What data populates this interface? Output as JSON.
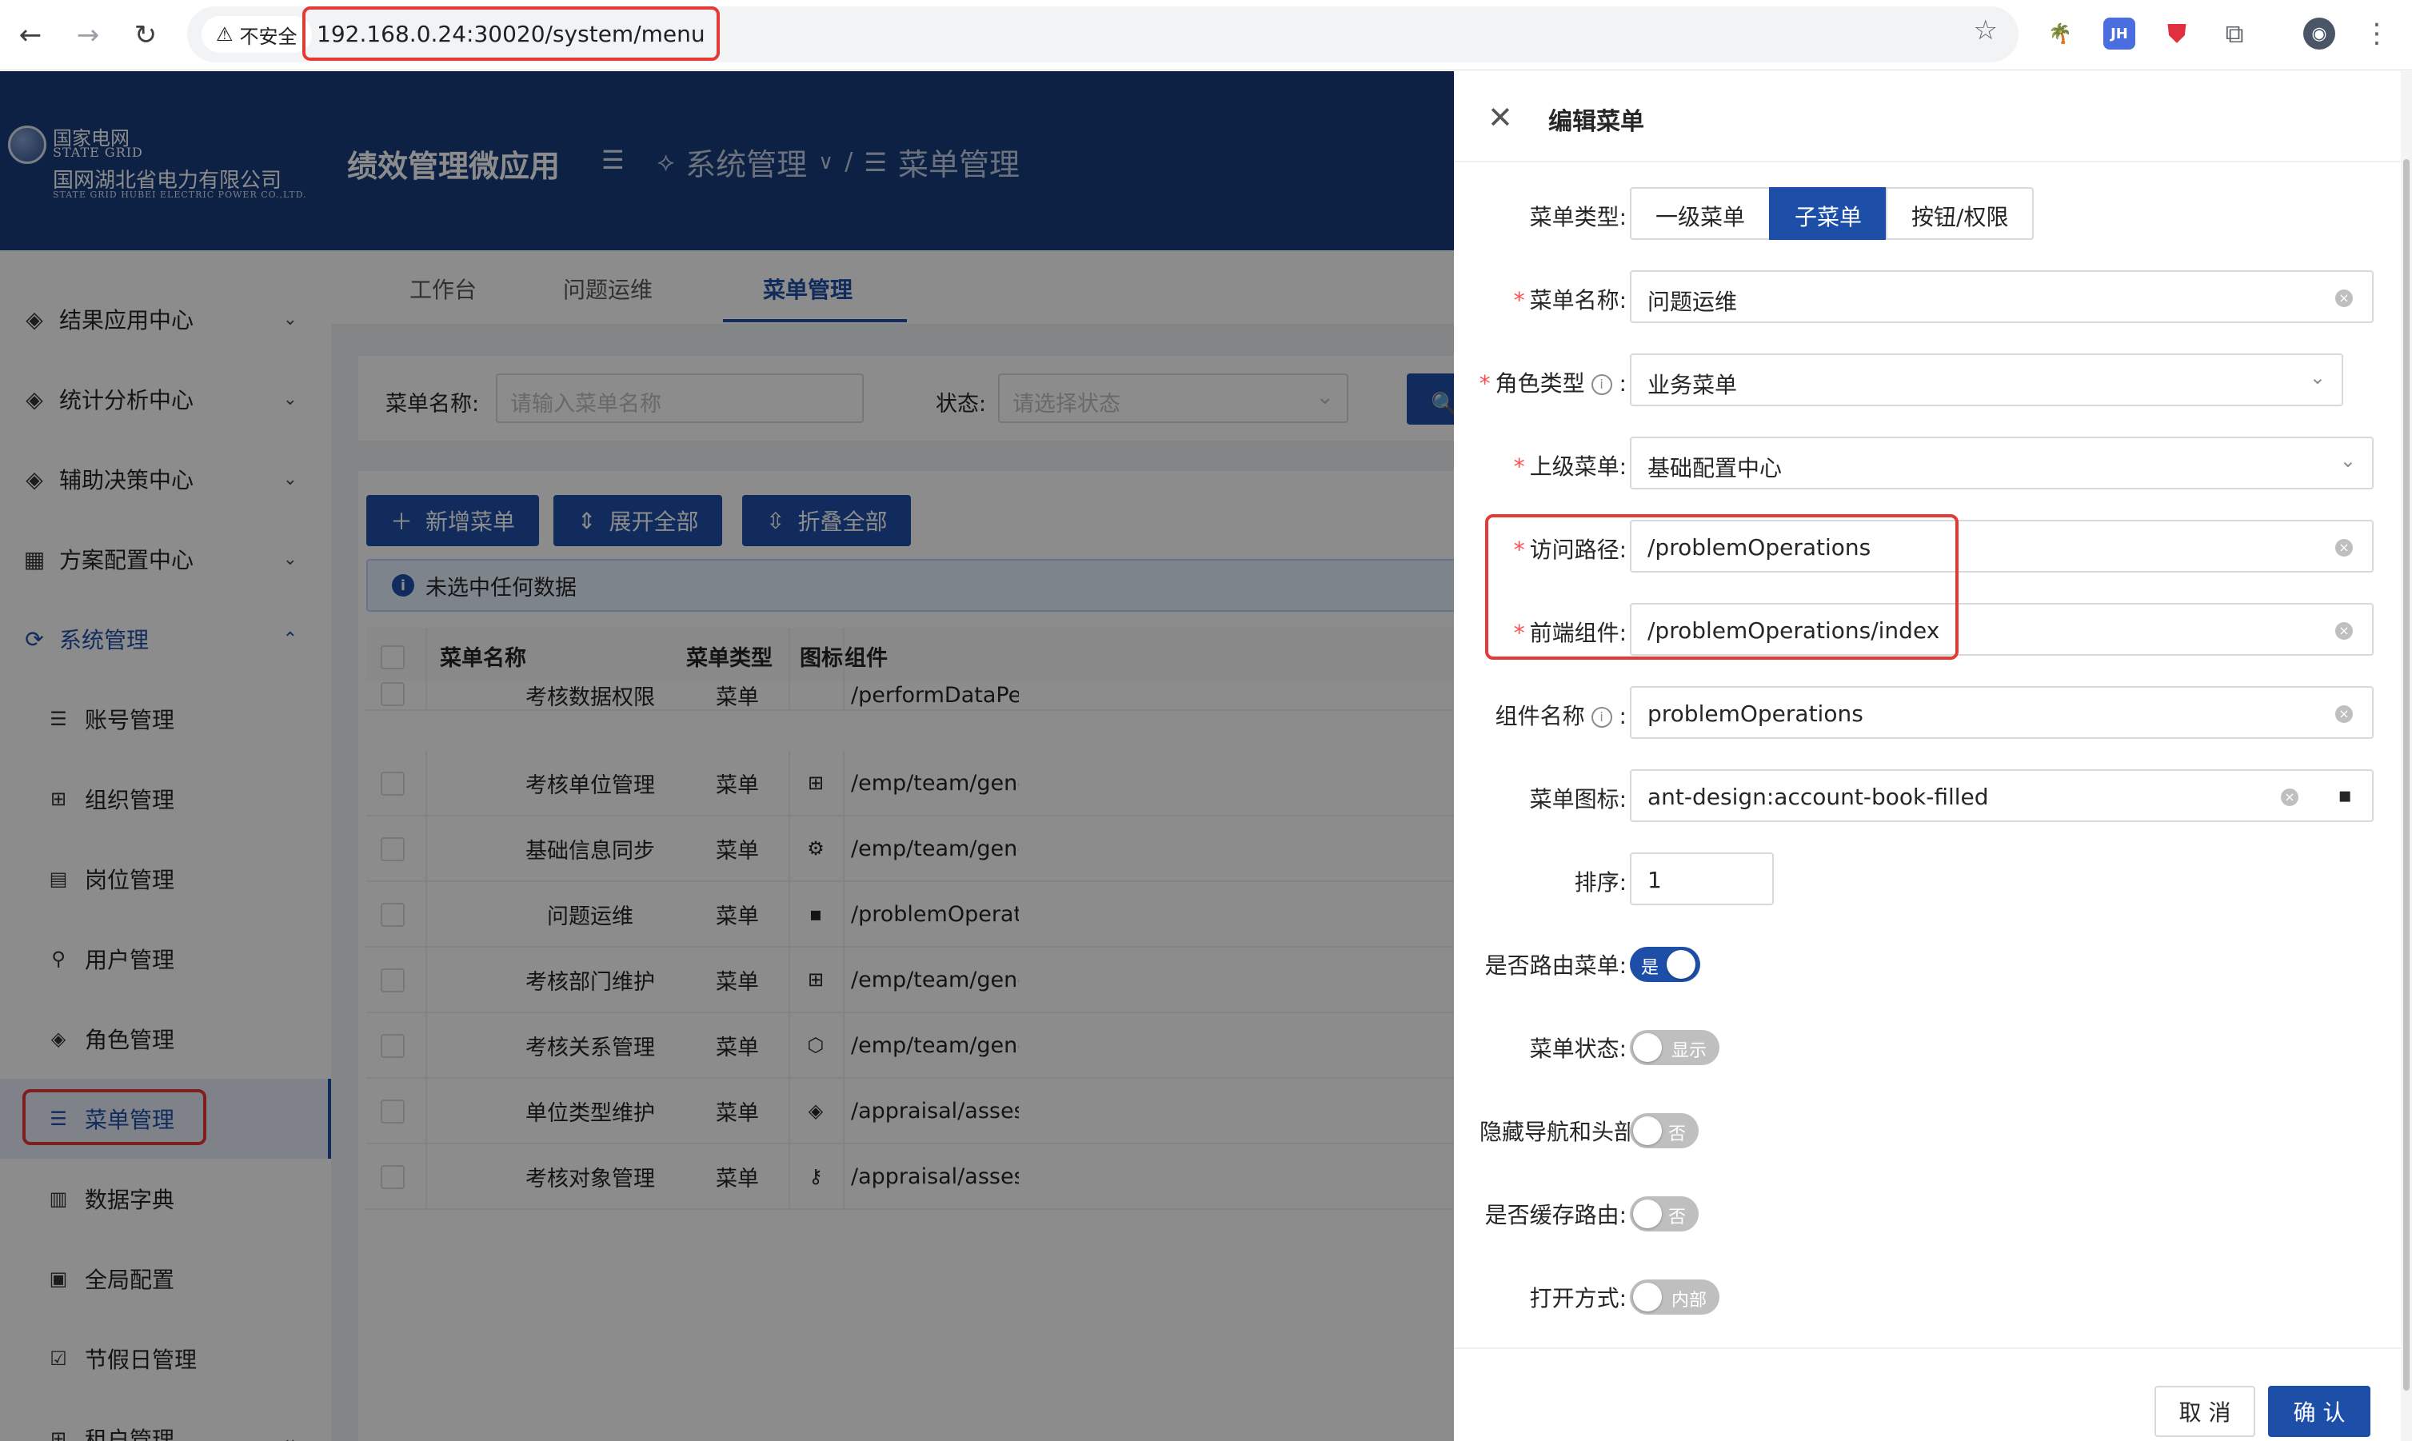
{
  "browser": {
    "security_label": "不安全",
    "url": "192.168.0.24:30020/system/menu",
    "extensions": [
      {
        "name": "ext-palm-icon",
        "glyph": "🌴",
        "color": "#e8a020"
      },
      {
        "name": "ext-jh-icon",
        "glyph": "JH",
        "color": "#4a6ee0"
      },
      {
        "name": "ext-shield-icon",
        "glyph": "⛊",
        "color": "#e03040"
      },
      {
        "name": "extensions-puzzle-icon",
        "glyph": "⧉",
        "color": "#5f6368"
      }
    ]
  },
  "header": {
    "logo": {
      "cn1": "国家电网",
      "en1": "STATE GRID",
      "cn2": "国网湖北省电力有限公司",
      "en2": "STATE GRID HUBEI ELECTRIC POWER CO.,LTD."
    },
    "app_title": "绩效管理微应用",
    "breadcrumb": {
      "parent": "系统管理",
      "current": "菜单管理"
    }
  },
  "sidebar": {
    "items": [
      {
        "label": "结果应用中心",
        "icon": "◈"
      },
      {
        "label": "统计分析中心",
        "icon": "◈"
      },
      {
        "label": "辅助决策中心",
        "icon": "◈"
      },
      {
        "label": "方案配置中心",
        "icon": "▦"
      },
      {
        "label": "系统管理",
        "icon": "⟳"
      }
    ],
    "children": [
      {
        "label": "账号管理",
        "icon": "☰"
      },
      {
        "label": "组织管理",
        "icon": "⊞"
      },
      {
        "label": "岗位管理",
        "icon": "▤"
      },
      {
        "label": "用户管理",
        "icon": "⚲"
      },
      {
        "label": "角色管理",
        "icon": "◈"
      },
      {
        "label": "菜单管理",
        "icon": "☰"
      },
      {
        "label": "数据字典",
        "icon": "▥"
      },
      {
        "label": "全局配置",
        "icon": "▣"
      },
      {
        "label": "节假日管理",
        "icon": "☑"
      },
      {
        "label": "租户管理",
        "icon": "⊞"
      }
    ]
  },
  "tabs": [
    "工作台",
    "问题运维",
    "菜单管理"
  ],
  "filter": {
    "name_label": "菜单名称:",
    "name_placeholder": "请输入菜单名称",
    "status_label": "状态:",
    "status_placeholder": "请选择状态",
    "query_label": "查"
  },
  "toolbar": {
    "add": "新增菜单",
    "expand": "展开全部",
    "collapse": "折叠全部"
  },
  "alert": "未选中任何数据",
  "table": {
    "columns": [
      "菜单名称",
      "菜单类型",
      "图标",
      "组件"
    ],
    "rows": [
      {
        "name": "考核数据权限",
        "type": "菜单",
        "icon": "",
        "component": "/performDataPermissio"
      },
      {
        "name": "考核单位管理",
        "type": "菜单",
        "icon": "⊞",
        "component": "/emp/team/general/dep"
      },
      {
        "name": "基础信息同步",
        "type": "菜单",
        "icon": "⚙",
        "component": "/emp/team/general/syn"
      },
      {
        "name": "问题运维",
        "type": "菜单",
        "icon": "▪",
        "component": "/problemOperations/inc"
      },
      {
        "name": "考核部门维护",
        "type": "菜单",
        "icon": "⊞",
        "component": "/emp/team/general/ass"
      },
      {
        "name": "考核关系管理",
        "type": "菜单",
        "icon": "⬡",
        "component": "/emp/team/general/rela"
      },
      {
        "name": "单位类型维护",
        "type": "菜单",
        "icon": "◈",
        "component": "/appraisal/assessInfo/c"
      },
      {
        "name": "考核对象管理",
        "type": "菜单",
        "icon": "⚷",
        "component": "/appraisal/assessInfo/as"
      }
    ]
  },
  "drawer": {
    "title": "编辑菜单",
    "menu_type_label": "菜单类型:",
    "menu_type_options": [
      "一级菜单",
      "子菜单",
      "按钮/权限"
    ],
    "menu_type_selected": "子菜单",
    "menu_name_label": "菜单名称:",
    "menu_name_value": "问题运维",
    "role_type_label": "角色类型",
    "role_type_value": "业务菜单",
    "parent_label": "上级菜单:",
    "parent_value": "基础配置中心",
    "path_label": "访问路径:",
    "path_value": "/problemOperations",
    "component_label": "前端组件:",
    "component_value": "/problemOperations/index",
    "component_name_label": "组件名称",
    "component_name_value": "problemOperations",
    "icon_label": "菜单图标:",
    "icon_value": "ant-design:account-book-filled",
    "order_label": "排序:",
    "order_value": "1",
    "route_label": "是否路由菜单:",
    "route_value": "是",
    "status_label": "菜单状态:",
    "status_value": "显示",
    "hide_label": "隐藏导航和头部",
    "hide_value": "否",
    "cache_label": "是否缓存路由:",
    "cache_value": "否",
    "open_label": "打开方式:",
    "open_value": "内部",
    "cancel": "取 消",
    "ok": "确 认"
  },
  "colors": {
    "primary": "#1e4fa8",
    "header": "#173c7c",
    "highlight": "#e53935"
  }
}
